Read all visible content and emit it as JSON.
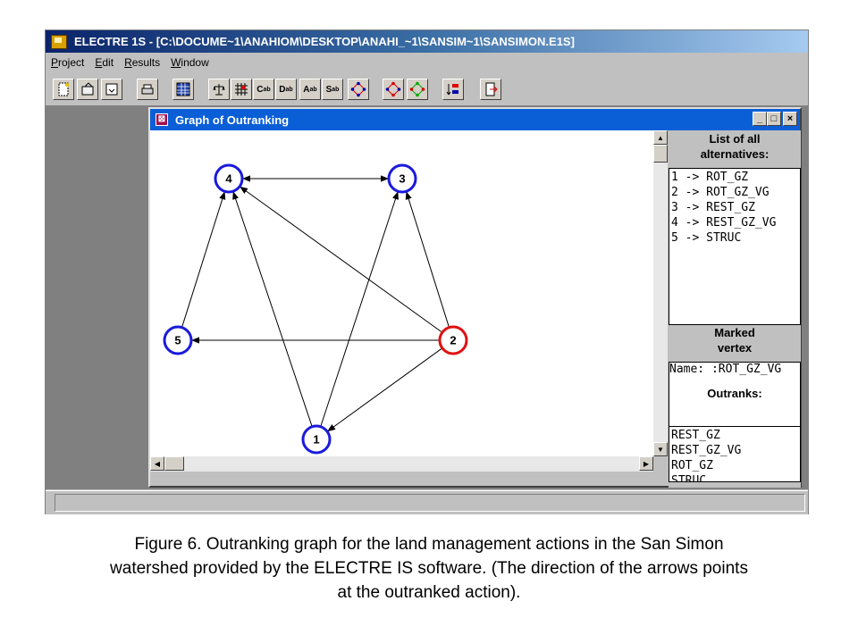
{
  "app": {
    "title": "ELECTRE 1S - [C:\\DOCUME~1\\ANAHIOM\\DESKTOP\\ANAHI_~1\\SANSIM~1\\SANSIMON.E1S]",
    "menu": [
      "Project",
      "Edit",
      "Results",
      "Window"
    ]
  },
  "toolbar": {
    "c_label": "C",
    "d_label": "D",
    "a_label": "A",
    "s_label": "S",
    "sub": "ab"
  },
  "child_window": {
    "title": "Graph of Outranking",
    "minimize": "_",
    "maximize": "□",
    "close": "×"
  },
  "graph": {
    "nodes": [
      {
        "id": "4",
        "color": "#1a1adc"
      },
      {
        "id": "3",
        "color": "#1a1adc"
      },
      {
        "id": "5",
        "color": "#1a1adc"
      },
      {
        "id": "2",
        "color": "#e01010"
      },
      {
        "id": "1",
        "color": "#1a1adc"
      }
    ],
    "edges": [
      {
        "from": "3",
        "to": "4"
      },
      {
        "from": "4",
        "to": "3"
      },
      {
        "from": "5",
        "to": "4"
      },
      {
        "from": "1",
        "to": "4"
      },
      {
        "from": "2",
        "to": "4"
      },
      {
        "from": "1",
        "to": "3"
      },
      {
        "from": "2",
        "to": "3"
      },
      {
        "from": "2",
        "to": "5"
      },
      {
        "from": "2",
        "to": "1"
      }
    ]
  },
  "side_panel": {
    "list_header": [
      "List of all",
      "alternatives:"
    ],
    "alternatives": [
      "1 -> ROT_GZ",
      "2 -> ROT_GZ_VG",
      "3 -> REST_GZ",
      "4 -> REST_GZ_VG",
      "5 -> STRUC"
    ],
    "marked_header": [
      "Marked",
      "vertex"
    ],
    "name_line": "Name: :ROT_GZ_VG",
    "outranks_label": "Outranks:",
    "outranks": [
      "REST_GZ",
      "REST_GZ_VG",
      "ROT_GZ",
      "STRUC"
    ]
  },
  "caption": {
    "line1": "Figure 6. Outranking graph for the land management actions in the San Simon",
    "line2": "watershed provided by the ELECTRE IS software. (The direction of the arrows points",
    "line3": "at the outranked action)."
  }
}
